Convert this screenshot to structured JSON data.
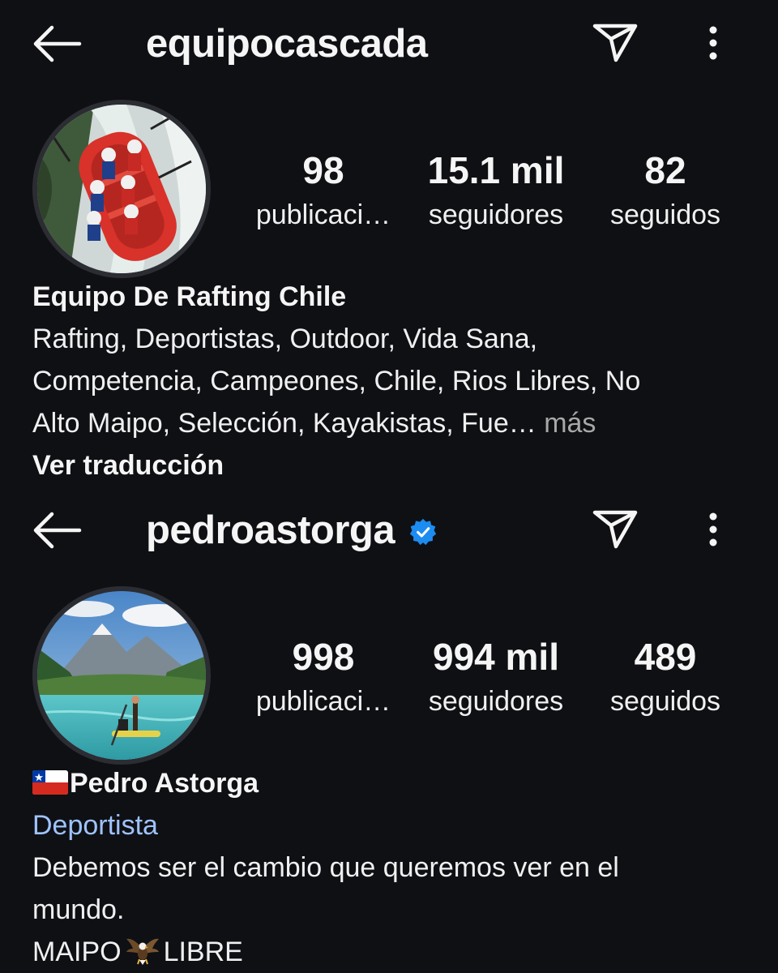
{
  "profiles": [
    {
      "username": "equipocascada",
      "verified": false,
      "stats": {
        "posts_value": "98",
        "posts_label": "publicaci…",
        "followers_value": "15.1 mil",
        "followers_label": "seguidores",
        "following_value": "82",
        "following_label": "seguidos"
      },
      "bio": {
        "name": "Equipo De Rafting Chile",
        "lines": [
          "Rafting, Deportistas, Outdoor, Vida Sana,",
          "Competencia, Campeones, Chile, Rios Libres, No",
          "Alto Maipo, Selección, Kayakistas, Fue…"
        ],
        "more_label": "más",
        "translate_label": "Ver traducción"
      }
    },
    {
      "username": "pedroastorga",
      "verified": true,
      "stats": {
        "posts_value": "998",
        "posts_label": "publicaci…",
        "followers_value": "994 mil",
        "followers_label": "seguidores",
        "following_value": "489",
        "following_label": "seguidos"
      },
      "bio": {
        "name": "Pedro Astorga",
        "category": "Deportista",
        "lines": [
          "Debemos ser el cambio que queremos ver en el",
          "mundo."
        ],
        "last_line_start": "MAIPO",
        "last_line_end": "LIBRE"
      }
    }
  ],
  "icons": {
    "back": "arrow-left-icon",
    "send": "paper-plane-icon",
    "more": "vertical-dots-icon",
    "verified": "verified-badge-icon",
    "flag": "chile-flag-icon",
    "eagle": "eagle-icon"
  },
  "colors": {
    "background": "#0f1014",
    "text": "#f5f5f5",
    "muted": "#a8a8a8",
    "category_link": "#9fc3ff",
    "verified_blue": "#1d8cf0"
  }
}
